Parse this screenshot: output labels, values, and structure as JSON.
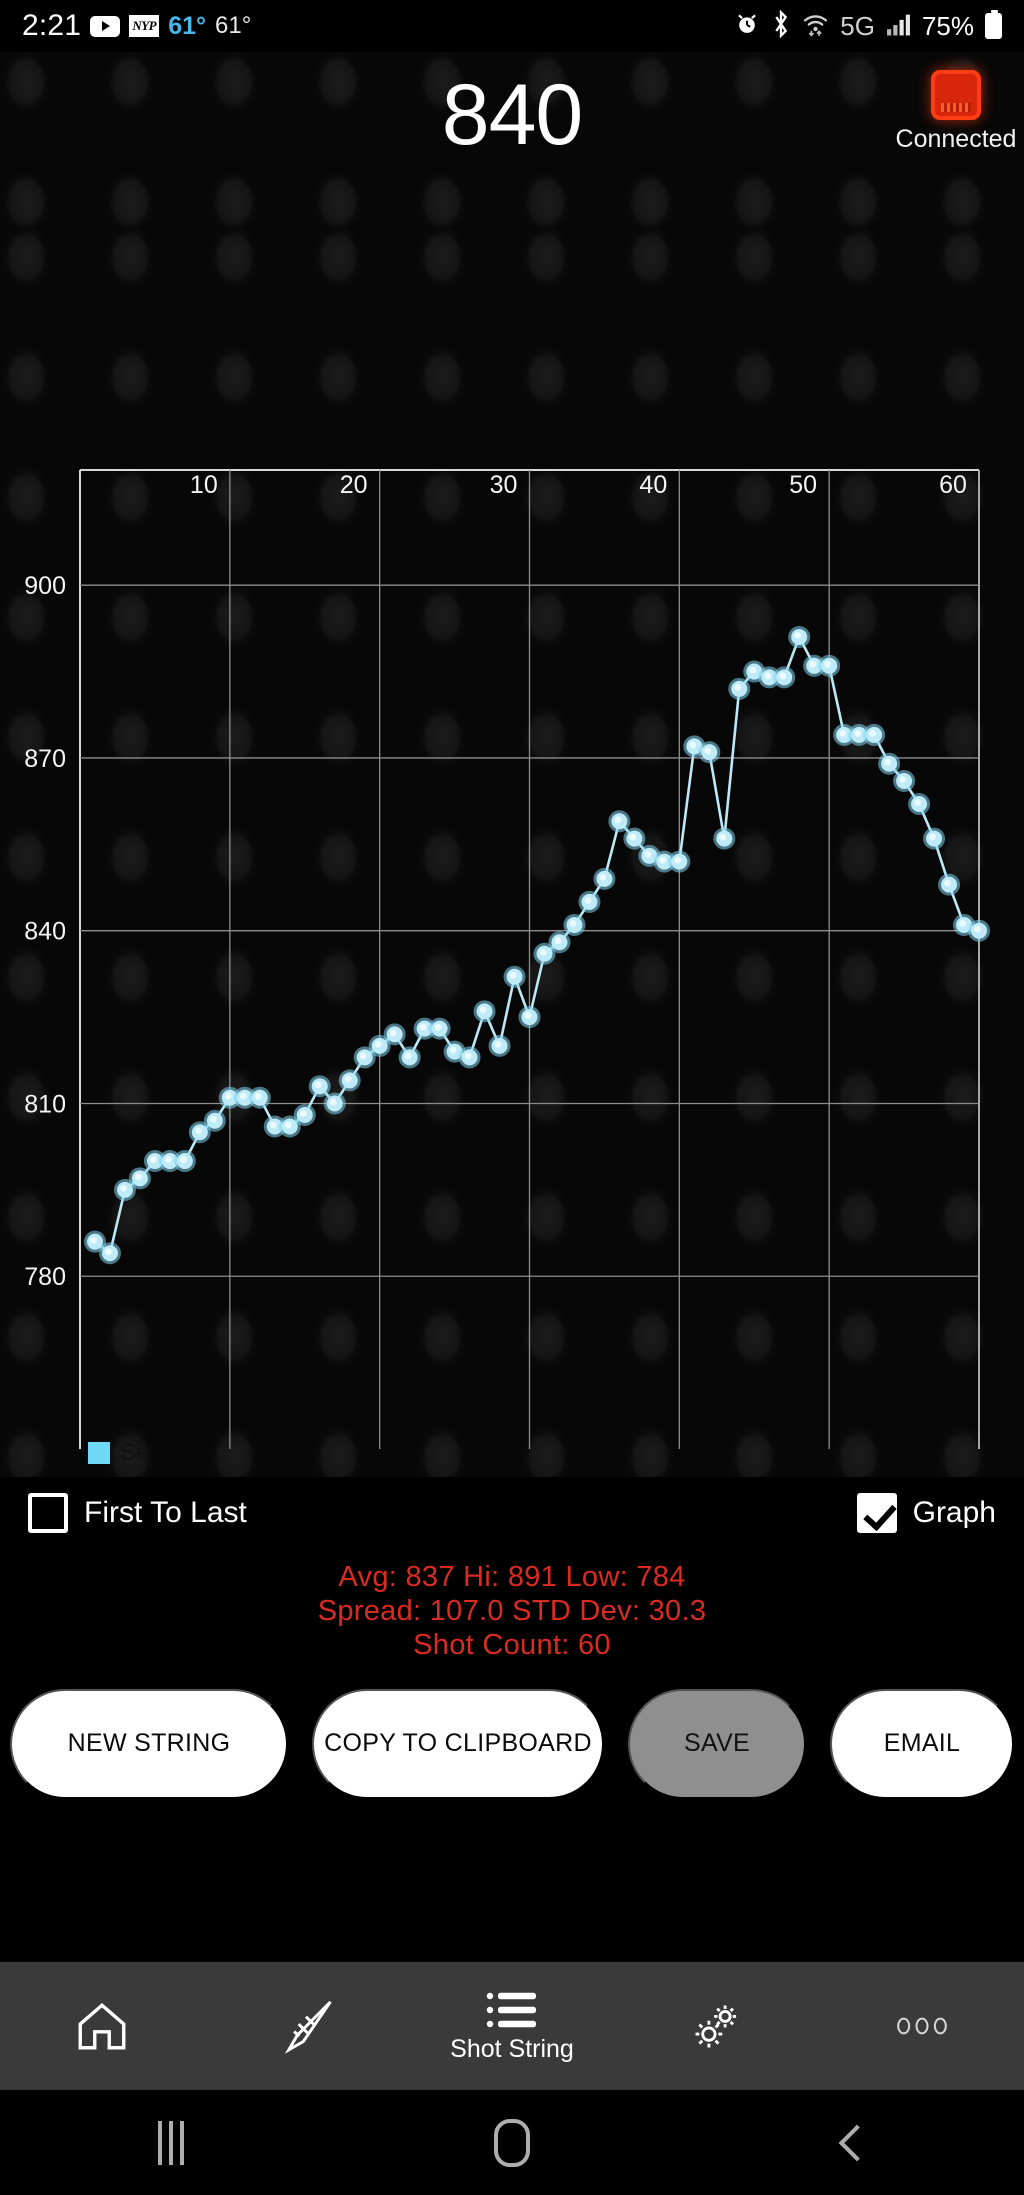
{
  "status_bar": {
    "time": "2:21",
    "youtube_icon": "youtube-icon",
    "nyp_label": "NYP",
    "temp_blue": "61°",
    "temp_white": "61°",
    "alarm_icon": "alarm-icon",
    "bluetooth_icon": "bluetooth-icon",
    "wifi_icon": "wifi-icon",
    "network_type": "5G",
    "signal_icon": "signal-bars-icon",
    "battery_percent": "75%",
    "battery_icon": "battery-icon"
  },
  "header": {
    "current_value": "840",
    "connection_status": "Connected",
    "device_icon": "chronograph-device-icon",
    "device_color": "#ff3c14"
  },
  "chart_data": {
    "type": "line",
    "title": "",
    "xlabel": "",
    "ylabel": "",
    "xlim": [
      0,
      60
    ],
    "ylim": [
      750,
      920
    ],
    "xticks": [
      "10",
      "20",
      "30",
      "40",
      "50",
      "60"
    ],
    "xtick_values": [
      10,
      20,
      30,
      40,
      50,
      60
    ],
    "yticks": [
      "900",
      "870",
      "840",
      "810",
      "780"
    ],
    "ytick_values": [
      900,
      870,
      840,
      810,
      780
    ],
    "grid": true,
    "legend": {
      "label": "Se",
      "position": "bottom-left",
      "color": "#6fd9f5"
    },
    "series": [
      {
        "name": "Se",
        "color": "#bfeaf8",
        "x": [
          1,
          2,
          3,
          4,
          5,
          6,
          7,
          8,
          9,
          10,
          11,
          12,
          13,
          14,
          15,
          16,
          17,
          18,
          19,
          20,
          21,
          22,
          23,
          24,
          25,
          26,
          27,
          28,
          29,
          30,
          31,
          32,
          33,
          34,
          35,
          36,
          37,
          38,
          39,
          40,
          41,
          42,
          43,
          44,
          45,
          46,
          47,
          48,
          49,
          50,
          51,
          52,
          53,
          54,
          55,
          56,
          57,
          58,
          59,
          60
        ],
        "values": [
          786,
          784,
          795,
          797,
          800,
          800,
          800,
          805,
          807,
          811,
          811,
          811,
          806,
          806,
          808,
          813,
          810,
          814,
          818,
          820,
          822,
          818,
          823,
          823,
          819,
          818,
          826,
          820,
          832,
          825,
          836,
          838,
          841,
          845,
          849,
          859,
          856,
          853,
          852,
          852,
          872,
          871,
          856,
          882,
          885,
          884,
          884,
          891,
          886,
          886,
          874,
          874,
          874,
          869,
          866,
          862,
          856,
          848,
          841,
          840
        ]
      }
    ]
  },
  "controls": {
    "first_to_last": {
      "label": "First To Last",
      "checked": false
    },
    "graph": {
      "label": "Graph",
      "checked": true
    }
  },
  "stats": {
    "line1": "Avg:  837   Hi:  891   Low:  784",
    "line2": "Spread:  107.0   STD Dev:  30.3",
    "line3": "Shot Count:  60",
    "color": "#d92b22"
  },
  "buttons": [
    {
      "label": "NEW STRING",
      "state": "enabled"
    },
    {
      "label": "COPY TO CLIPBOARD",
      "state": "enabled"
    },
    {
      "label": "SAVE",
      "state": "disabled"
    },
    {
      "label": "EMAIL",
      "state": "enabled"
    }
  ],
  "tabbar": [
    {
      "icon": "home-icon",
      "label": ""
    },
    {
      "icon": "rifle-icon",
      "label": ""
    },
    {
      "icon": "list-icon",
      "label": "Shot String"
    },
    {
      "icon": "gears-icon",
      "label": ""
    },
    {
      "icon": "more-dots-icon",
      "label": ""
    }
  ],
  "android_nav": {
    "recents": "recents-icon",
    "home": "home-button-icon",
    "back": "back-icon"
  }
}
